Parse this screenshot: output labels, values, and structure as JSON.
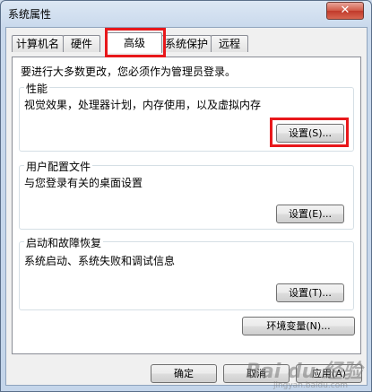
{
  "window": {
    "title": "系统属性",
    "close_glyph": "✕"
  },
  "tabs": [
    {
      "label": "计算机名",
      "active": false
    },
    {
      "label": "硬件",
      "active": false
    },
    {
      "label": "高级",
      "active": true
    },
    {
      "label": "系统保护",
      "active": false
    },
    {
      "label": "远程",
      "active": false
    }
  ],
  "advanced": {
    "admin_notice": "要进行大多数更改，您必须作为管理员登录。",
    "performance": {
      "title": "性能",
      "description": "视觉效果，处理器计划，内存使用，以及虚拟内存",
      "button": "设置(S)..."
    },
    "user_profiles": {
      "title": "用户配置文件",
      "description": "与您登录有关的桌面设置",
      "button": "设置(E)..."
    },
    "startup_recovery": {
      "title": "启动和故障恢复",
      "description": "系统启动、系统失败和调试信息",
      "button": "设置(T)..."
    },
    "env_button": "环境变量(N)..."
  },
  "footer": {
    "ok": "确定",
    "cancel": "取消",
    "apply": "应用(A)"
  },
  "watermark": {
    "logo": "Bai du 经验",
    "url": "jingyan.baidu.com"
  },
  "highlight_color": "#e8181b"
}
